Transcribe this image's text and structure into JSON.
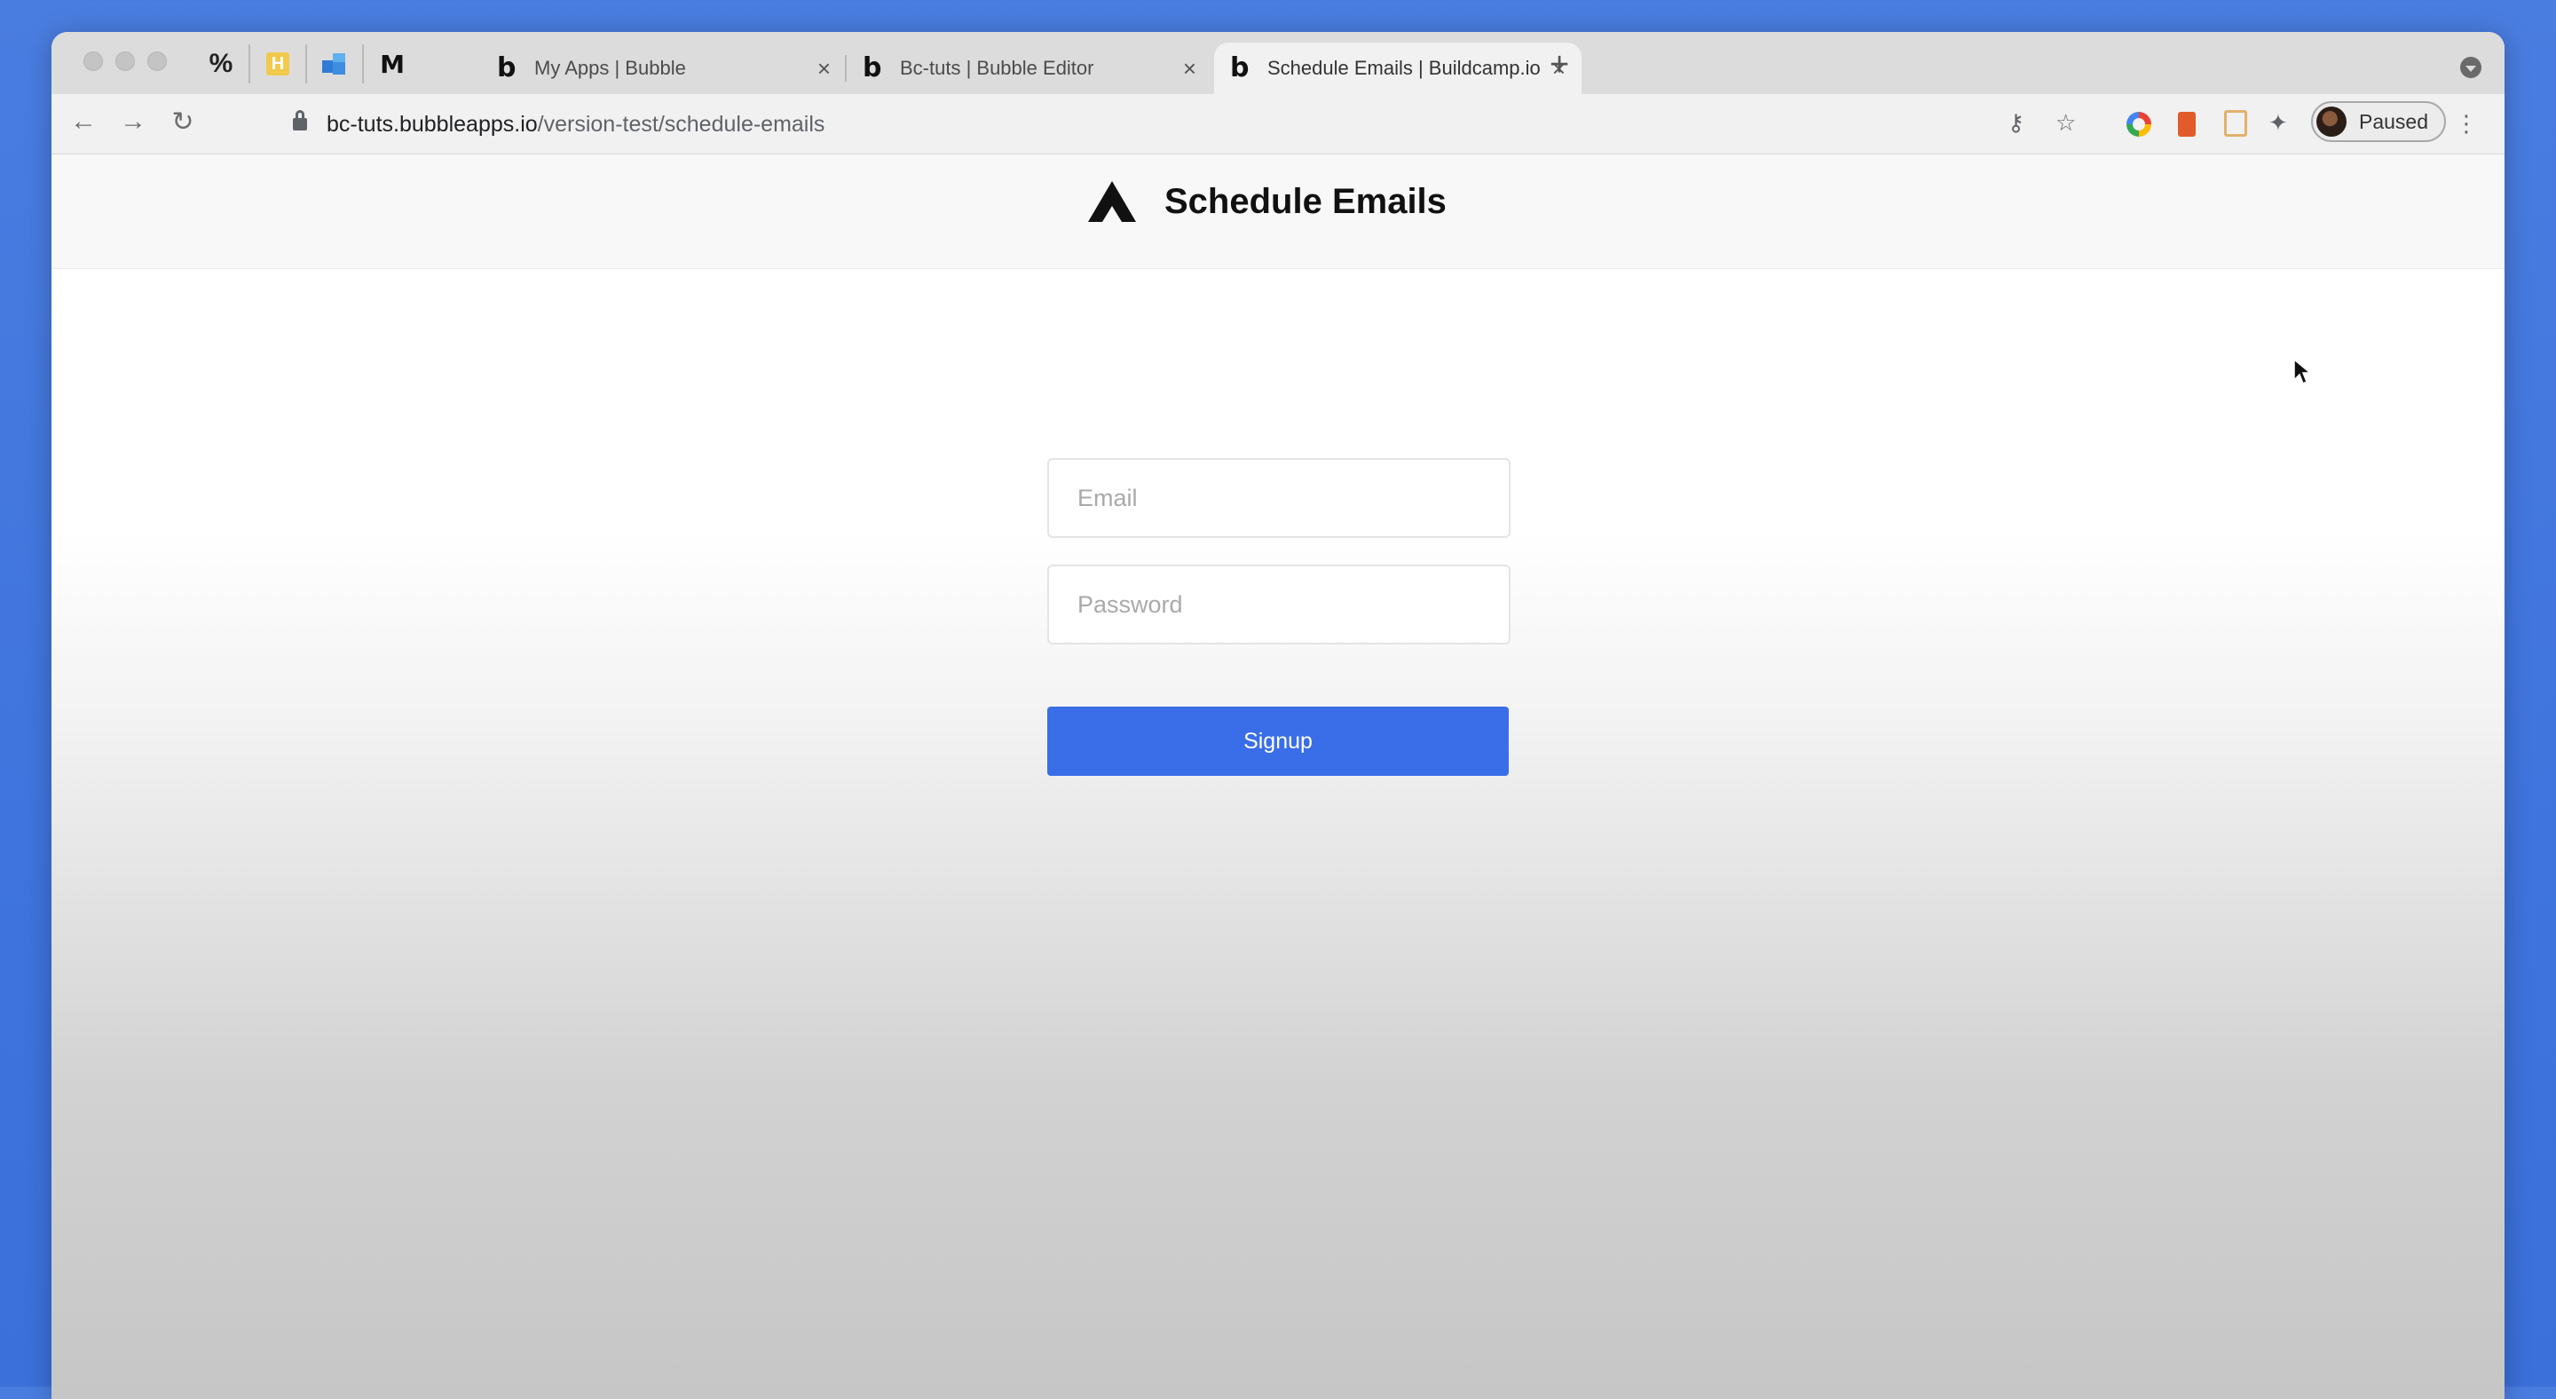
{
  "browser": {
    "pinned_tabs": [
      {
        "icon": "percent-icon",
        "glyph": "%"
      },
      {
        "icon": "h-app-icon",
        "glyph": "H"
      },
      {
        "icon": "blocks-app-icon"
      },
      {
        "icon": "m-app-icon",
        "glyph": "M"
      }
    ],
    "tabs": [
      {
        "title": "My Apps | Bubble",
        "favicon": "b",
        "close": "×"
      },
      {
        "title": "Bc-tuts | Bubble Editor",
        "favicon": "b",
        "close": "×"
      },
      {
        "title": "Schedule Emails | Buildcamp.io",
        "favicon": "b",
        "close": "×",
        "active": true
      }
    ],
    "new_tab": "+",
    "url": {
      "host": "bc-tuts.bubbleapps.io",
      "path": "/version-test/schedule-emails"
    },
    "profile": {
      "status": "Paused"
    },
    "colors": {
      "accent": "#3a6ee8",
      "desktop": "#4a7de0"
    }
  },
  "page": {
    "title": "Schedule Emails",
    "email": {
      "placeholder": "Email",
      "value": ""
    },
    "password": {
      "placeholder": "Password",
      "value": ""
    },
    "signup_label": "Signup"
  }
}
